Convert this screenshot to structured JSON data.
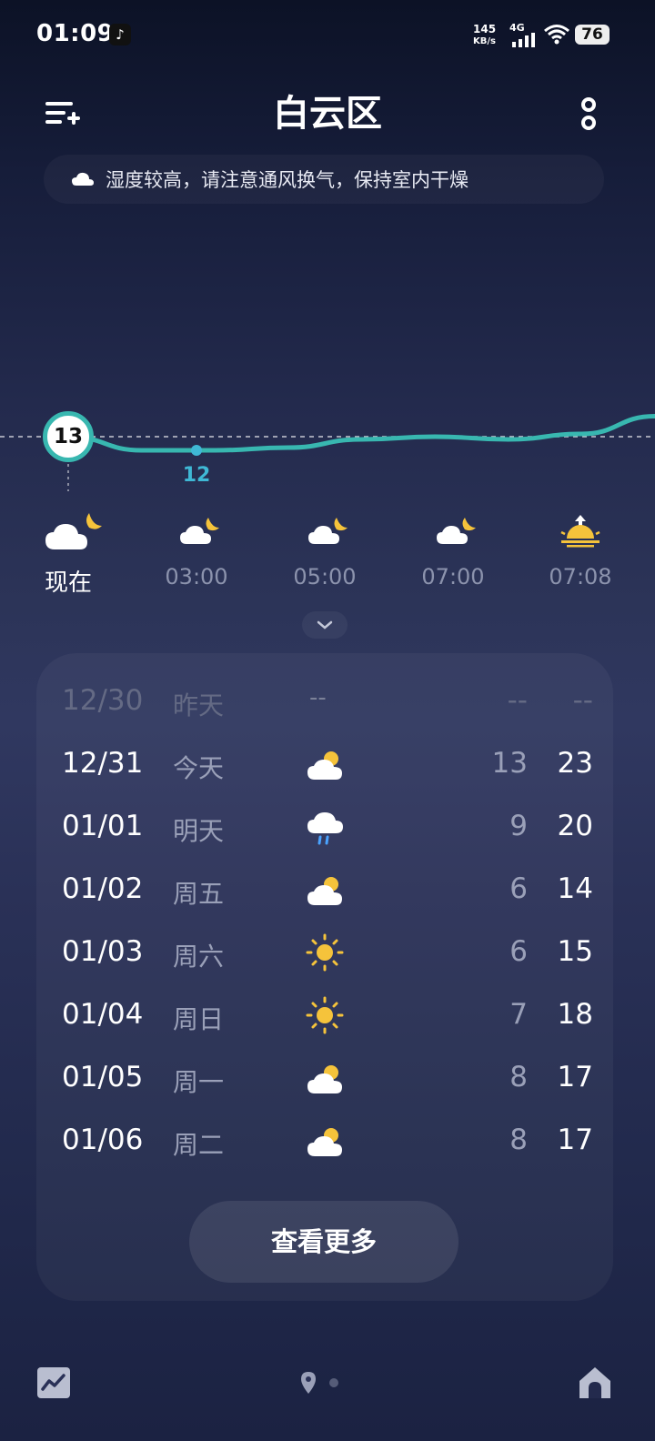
{
  "status_bar": {
    "time": "01:09",
    "app_icon": "tiktok-icon",
    "net_speed_value": "145",
    "net_speed_unit": "KB/s",
    "network": "4G",
    "battery": "76"
  },
  "header": {
    "title": "白云区",
    "left_icon": "add-city-icon",
    "right_icon": "more-options-icon"
  },
  "tip": {
    "icon": "cloud-icon",
    "text": "湿度较高，请注意通风换气，保持室内干燥"
  },
  "hourly": {
    "current_temp": "13",
    "min_label": "12",
    "temps": [
      13,
      12,
      12,
      12.2,
      12.8,
      13,
      12.8,
      13.2,
      14.5
    ],
    "items": [
      {
        "time": "现在",
        "icon": "moon-cloud-icon"
      },
      {
        "time": "03:00",
        "icon": "moon-cloud-icon"
      },
      {
        "time": "05:00",
        "icon": "moon-cloud-icon"
      },
      {
        "time": "07:00",
        "icon": "moon-cloud-icon"
      },
      {
        "time": "07:08",
        "icon": "sunrise-icon"
      }
    ]
  },
  "forecast": {
    "rows": [
      {
        "date": "12/30",
        "day": "昨天",
        "icon": "",
        "dash": "--",
        "low": "--",
        "high": "--",
        "past": true
      },
      {
        "date": "12/31",
        "day": "今天",
        "icon": "partly-cloudy-icon",
        "low": "13",
        "high": "23"
      },
      {
        "date": "01/01",
        "day": "明天",
        "icon": "rain-cloud-icon",
        "low": "9",
        "high": "20"
      },
      {
        "date": "01/02",
        "day": "周五",
        "icon": "partly-cloudy-icon",
        "low": "6",
        "high": "14"
      },
      {
        "date": "01/03",
        "day": "周六",
        "icon": "sun-icon",
        "low": "6",
        "high": "15"
      },
      {
        "date": "01/04",
        "day": "周日",
        "icon": "sun-icon",
        "low": "7",
        "high": "18"
      },
      {
        "date": "01/05",
        "day": "周一",
        "icon": "partly-cloudy-icon",
        "low": "8",
        "high": "17"
      },
      {
        "date": "01/06",
        "day": "周二",
        "icon": "partly-cloudy-icon",
        "low": "8",
        "high": "17"
      }
    ],
    "more_label": "查看更多"
  },
  "bottom_bar": {
    "left_icon": "trend-chart-icon",
    "center_icon": "location-pin-icon",
    "right_icon": "home-icon"
  },
  "colors": {
    "accent_teal": "#38b7b0",
    "label_blue": "#3fb8d5",
    "sun_yellow": "#f5c33b",
    "rain_blue": "#4aa3ff"
  }
}
